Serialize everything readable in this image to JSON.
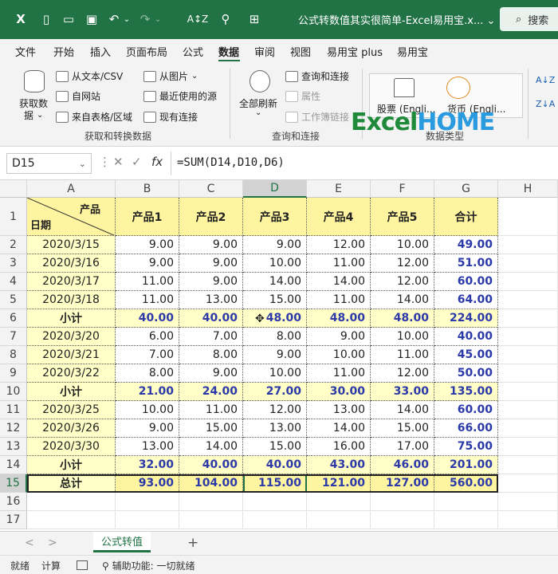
{
  "titlebar": {
    "title": "公式转数值其实很简单-Excel易用宝.x...",
    "title_arrow": "⌄",
    "search_label": "搜索",
    "search_icon": "⌕",
    "icons": {
      "excel": "X",
      "new": "▯",
      "open": "▭",
      "save": "▣",
      "undo": "↶",
      "undo_drop": "⌄",
      "redo": "↷",
      "redo_drop": "⌄",
      "sort": "A↕Z",
      "find": "⚲",
      "tool": "⊞"
    }
  },
  "menu": [
    "文件",
    "开始",
    "插入",
    "页面布局",
    "公式",
    "数据",
    "审阅",
    "视图",
    "易用宝 plus",
    "易用宝"
  ],
  "ribbon": {
    "get_data": "获取数",
    "get_data2": "据",
    "get_data_arrow": "⌄",
    "from_text": "从文本/CSV",
    "from_web": "自网站",
    "from_table": "来自表格/区域",
    "from_picture": "从图片",
    "from_picture_arrow": "⌄",
    "recent_sources": "最近使用的源",
    "existing_conn": "现有连接",
    "group1": "获取和转换数据",
    "refresh_all": "全部刷新",
    "refresh_arrow": "⌄",
    "query_conn": "查询和连接",
    "properties": "属性",
    "workbook_links": "工作簿链接",
    "group2": "查询和连接",
    "stocks": "股票 (Engli...",
    "currency": "货币 (Engli...",
    "group3": "数据类型",
    "logo_a": "Excel",
    "logo_b": "HOME",
    "sort_az": "A↓Z",
    "sort_za": "Z↓A"
  },
  "formula_bar": {
    "name_box": "D15",
    "name_arrow": "⌄",
    "more": "⋮",
    "cancel": "✕",
    "enter": "✓",
    "fx": "fx",
    "formula": "=SUM(D14,D10,D6)"
  },
  "sheet": {
    "columns": [
      "A",
      "B",
      "C",
      "D",
      "E",
      "F",
      "G",
      "H"
    ],
    "rows": [
      "1",
      "2",
      "3",
      "4",
      "5",
      "6",
      "7",
      "8",
      "9",
      "10",
      "11",
      "12",
      "13",
      "14",
      "15",
      "16",
      "17"
    ],
    "header_product": "产品",
    "header_date": "日期",
    "product_headers": [
      "产品1",
      "产品2",
      "产品3",
      "产品4",
      "产品5",
      "合计"
    ],
    "data_rows": [
      {
        "label": "2020/3/15",
        "values": [
          "9.00",
          "9.00",
          "9.00",
          "12.00",
          "10.00",
          "49.00"
        ],
        "subtotal": false
      },
      {
        "label": "2020/3/16",
        "values": [
          "9.00",
          "9.00",
          "10.00",
          "11.00",
          "12.00",
          "51.00"
        ],
        "subtotal": false
      },
      {
        "label": "2020/3/17",
        "values": [
          "11.00",
          "9.00",
          "14.00",
          "14.00",
          "12.00",
          "60.00"
        ],
        "subtotal": false
      },
      {
        "label": "2020/3/18",
        "values": [
          "11.00",
          "13.00",
          "15.00",
          "11.00",
          "14.00",
          "64.00"
        ],
        "subtotal": false
      },
      {
        "label": "小计",
        "values": [
          "40.00",
          "40.00",
          "48.00",
          "48.00",
          "48.00",
          "224.00"
        ],
        "subtotal": true
      },
      {
        "label": "2020/3/20",
        "values": [
          "6.00",
          "7.00",
          "8.00",
          "9.00",
          "10.00",
          "40.00"
        ],
        "subtotal": false
      },
      {
        "label": "2020/3/21",
        "values": [
          "7.00",
          "8.00",
          "9.00",
          "10.00",
          "11.00",
          "45.00"
        ],
        "subtotal": false
      },
      {
        "label": "2020/3/22",
        "values": [
          "8.00",
          "9.00",
          "10.00",
          "11.00",
          "12.00",
          "50.00"
        ],
        "subtotal": false
      },
      {
        "label": "小计",
        "values": [
          "21.00",
          "24.00",
          "27.00",
          "30.00",
          "33.00",
          "135.00"
        ],
        "subtotal": true
      },
      {
        "label": "2020/3/25",
        "values": [
          "10.00",
          "11.00",
          "12.00",
          "13.00",
          "14.00",
          "60.00"
        ],
        "subtotal": false
      },
      {
        "label": "2020/3/26",
        "values": [
          "9.00",
          "15.00",
          "13.00",
          "14.00",
          "15.00",
          "66.00"
        ],
        "subtotal": false
      },
      {
        "label": "2020/3/30",
        "values": [
          "13.00",
          "14.00",
          "15.00",
          "16.00",
          "17.00",
          "75.00"
        ],
        "subtotal": false
      },
      {
        "label": "小计",
        "values": [
          "32.00",
          "40.00",
          "40.00",
          "43.00",
          "46.00",
          "201.00"
        ],
        "subtotal": true
      },
      {
        "label": "总计",
        "values": [
          "93.00",
          "104.00",
          "115.00",
          "121.00",
          "127.00",
          "560.00"
        ],
        "subtotal": true
      }
    ],
    "selected_cell": "D15"
  },
  "tabs": {
    "prev": "<",
    "next": ">",
    "sheet_name": "公式转值",
    "add": "+"
  },
  "status": {
    "ready": "就绪",
    "calc": "计算",
    "accessibility": "辅助功能: 一切就绪"
  }
}
